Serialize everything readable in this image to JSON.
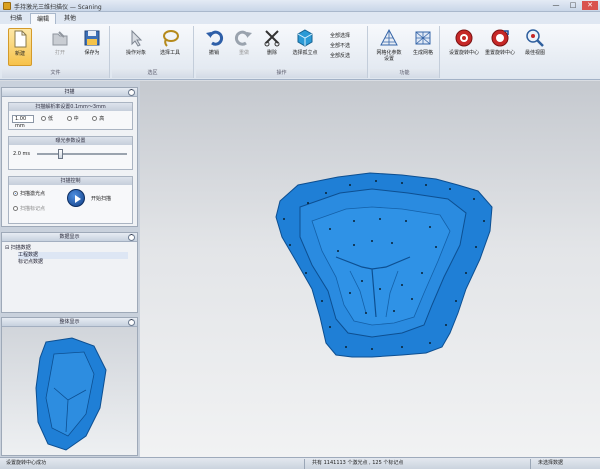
{
  "window": {
    "title": "手持激光三维扫描仪 — Scaning",
    "minimize": "—",
    "maximize": "□",
    "close": "✕"
  },
  "tabs": [
    {
      "label": "扫描",
      "active": false
    },
    {
      "label": "编辑",
      "active": true
    },
    {
      "label": "其他",
      "active": false
    }
  ],
  "ribbon": {
    "file": {
      "label": "文件",
      "new": "新建",
      "open": "打开",
      "save_as": "保存为"
    },
    "select": {
      "label": "选区",
      "operate_object": "操作对象",
      "select_tool": "选择工具"
    },
    "operate": {
      "label": "操作",
      "undo": "撤销",
      "redo": "重做",
      "delete": "删除",
      "select_isolated": "选择孤立点",
      "select_all": "全部选择",
      "select_none": "全部不选",
      "invert": "全部反选"
    },
    "function": {
      "label": "功能",
      "mesh_params": "网格化参数设置",
      "generate_mesh": "生成网格"
    },
    "view": {
      "set_center": "设置旋转中心",
      "reset_center": "重置旋转中心",
      "best_view": "最佳视图"
    }
  },
  "scan_panel": {
    "title": "扫描",
    "resolution": {
      "title": "扫描解析率设置0.1mm～3mm",
      "value": "1.00",
      "unit": "mm",
      "options": [
        "低",
        "中",
        "高"
      ]
    },
    "exposure": {
      "title": "曝光参数设置",
      "value": "2.0",
      "unit": "ms",
      "level": 0.25
    },
    "control": {
      "title": "扫描控制",
      "option_laser": "扫描激光点",
      "option_marker": "扫描标记点",
      "start": "开始扫描"
    }
  },
  "data_panel": {
    "title": "数据显示",
    "items": [
      {
        "label": "扫描数据",
        "level": 0
      },
      {
        "label": "工程数据",
        "level": 1
      },
      {
        "label": "标记点数据",
        "level": 1
      }
    ]
  },
  "preview_panel": {
    "title": "整体显示"
  },
  "status": {
    "left": "设置旋转中心成功",
    "middle": "共有 1141113 个激光点 , 125 个标记点",
    "right": "未选择数据"
  },
  "colors": {
    "mesh_blue": "#1f7fd6",
    "accent_blue": "#2a6bd0"
  }
}
